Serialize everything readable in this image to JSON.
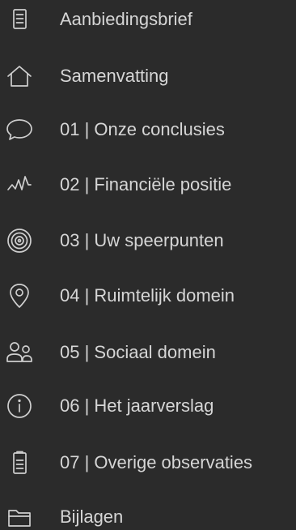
{
  "nav": {
    "items": [
      {
        "label": "Aanbiedingsbrief",
        "icon": "document-icon"
      },
      {
        "label": "Samenvatting",
        "icon": "home-icon"
      },
      {
        "label": "01 | Onze conclusies",
        "icon": "speech-bubble-icon"
      },
      {
        "label": "02 | Financiële positie",
        "icon": "activity-icon"
      },
      {
        "label": "03 | Uw speerpunten",
        "icon": "target-icon"
      },
      {
        "label": "04 | Ruimtelijk domein",
        "icon": "map-pin-icon"
      },
      {
        "label": "05 | Sociaal domein",
        "icon": "users-icon"
      },
      {
        "label": "06 | Het jaarverslag",
        "icon": "info-icon"
      },
      {
        "label": "07 | Overige observaties",
        "icon": "clipboard-icon"
      },
      {
        "label": "Bijlagen",
        "icon": "folder-icon"
      }
    ]
  },
  "colors": {
    "background": "#2b2b2b",
    "text": "#d6d6d6",
    "icon": "#cfcfcf"
  }
}
